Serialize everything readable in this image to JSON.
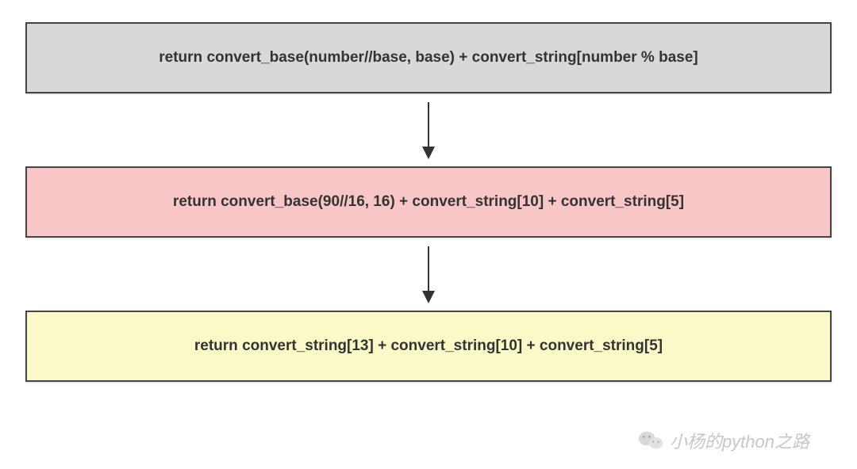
{
  "boxes": {
    "step1": "return convert_base(number//base, base) + convert_string[number % base]",
    "step2": "return convert_base(90//16, 16) + convert_string[10] + convert_string[5]",
    "step3": "return convert_string[13] + convert_string[10] + convert_string[5]"
  },
  "watermark": {
    "text": "小杨的python之路"
  },
  "colors": {
    "box1_bg": "#d8d8d8",
    "box2_bg": "#f8c6c6",
    "box3_bg": "#fbf9c8",
    "border": "#444444",
    "text": "#333333"
  }
}
